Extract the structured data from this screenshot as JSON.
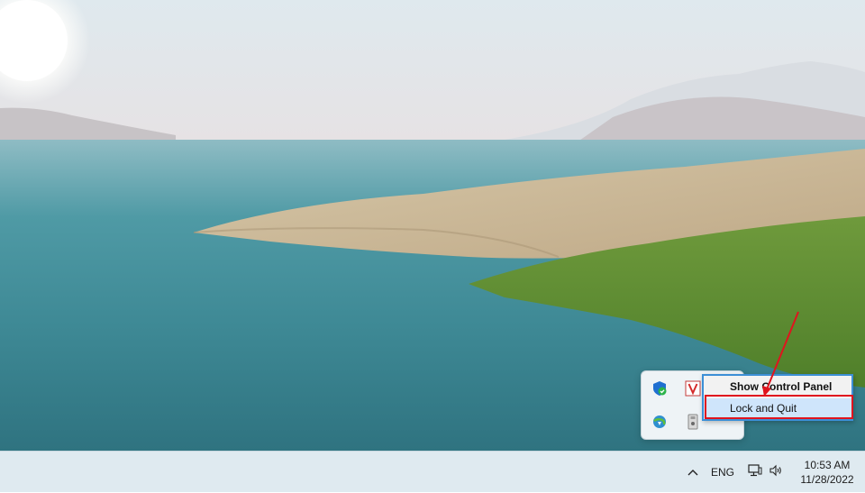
{
  "desktop": {
    "wallpaper": "lake-landscape"
  },
  "tray_flyout": {
    "icons": [
      "windows-security-icon",
      "v-app-icon",
      "internet-download-manager-icon",
      "usb-drive-icon"
    ]
  },
  "context_menu": {
    "items": [
      {
        "label": "Show Control Panel",
        "bold": true
      },
      {
        "label": "Lock and Quit",
        "highlighted": true
      }
    ]
  },
  "taskbar": {
    "language": "ENG",
    "time": "10:53 AM",
    "date": "11/28/2022"
  },
  "colors": {
    "highlight_box": "#e0141e",
    "menu_border": "#3c8fd6",
    "menu_hover": "#cfe5fb"
  }
}
